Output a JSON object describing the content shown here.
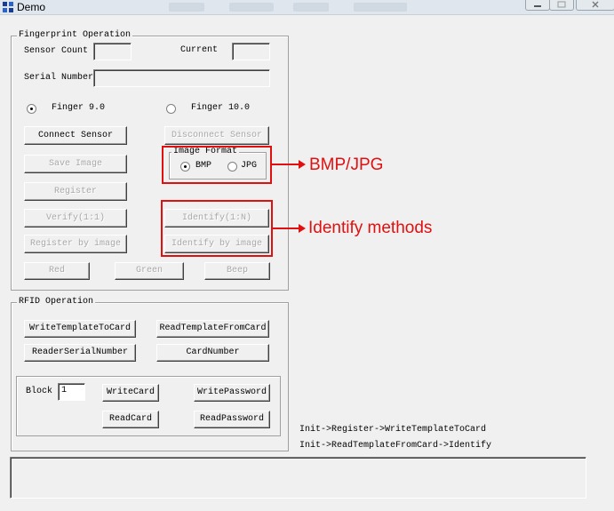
{
  "window": {
    "title": "Demo"
  },
  "fingerprint": {
    "group_label": "Fingerprint Operation",
    "sensor_count_label": "Sensor Count",
    "sensor_count_value": "",
    "current_label": "Current",
    "current_value": "",
    "serial_number_label": "Serial Number",
    "serial_number_value": "",
    "finger9_label": "Finger 9.0",
    "finger10_label": "Finger 10.0",
    "connect_label": "Connect Sensor",
    "disconnect_label": "Disconnect Sensor",
    "save_image_label": "Save Image",
    "image_format": {
      "group_label": "Image Format",
      "bmp_label": "BMP",
      "jpg_label": "JPG"
    },
    "register_label": "Register",
    "verify_label": "Verify(1:1)",
    "identify_label": "Identify(1:N)",
    "register_image_label": "Register by image",
    "identify_image_label": "Identify by image",
    "red_label": "Red",
    "green_label": "Green",
    "beep_label": "Beep"
  },
  "rfid": {
    "group_label": "RFID Operation",
    "write_template_label": "WriteTemplateToCard",
    "read_template_label": "ReadTemplateFromCard",
    "reader_serial_label": "ReaderSerialNumber",
    "card_number_label": "CardNumber",
    "block_label": "Block",
    "block_value": "1",
    "write_card_label": "WriteCard",
    "write_password_label": "WritePassword",
    "read_card_label": "ReadCard",
    "read_password_label": "ReadPassword"
  },
  "notes": {
    "line1": "Init->Register->WriteTemplateToCard",
    "line2": "Init->ReadTemplateFromCard->Identify"
  },
  "annotations": {
    "format_text": "BMP/JPG",
    "identify_text": "Identify methods",
    "color": "#e01010"
  }
}
